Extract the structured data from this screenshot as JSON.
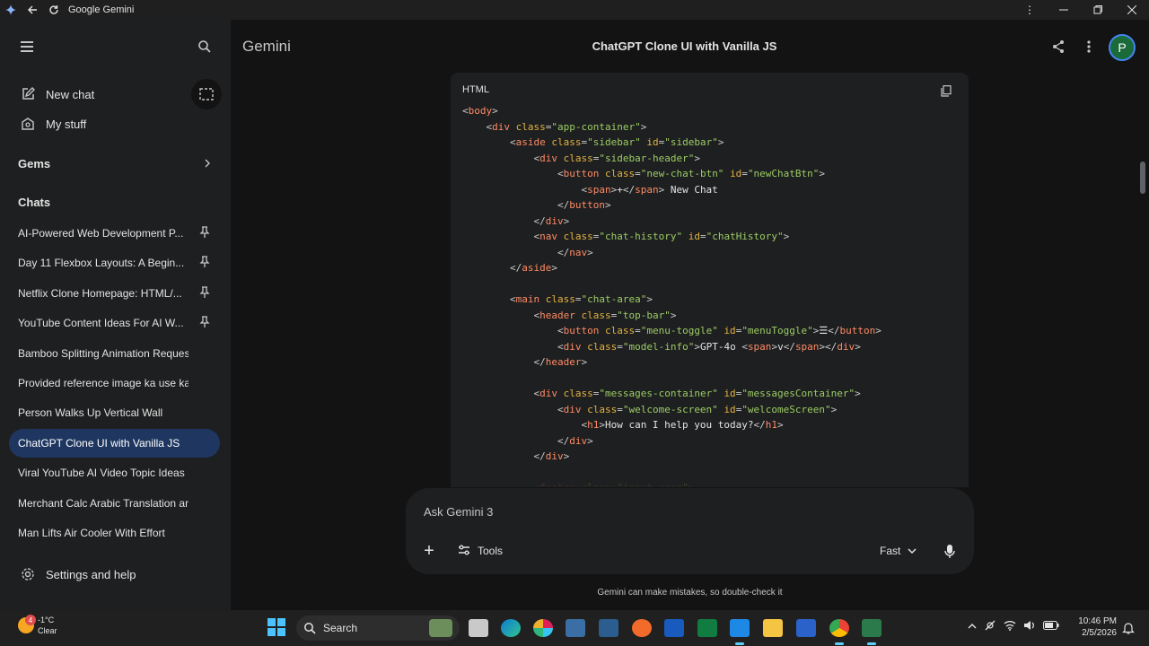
{
  "window": {
    "title": "Google Gemini",
    "controls": [
      "minimize",
      "maximize",
      "close"
    ]
  },
  "sidebar": {
    "new_chat": "New chat",
    "my_stuff": "My stuff",
    "gems": "Gems",
    "chats_header": "Chats",
    "chats": [
      {
        "label": "AI-Powered Web Development P...",
        "pinned": true
      },
      {
        "label": "Day 11 Flexbox Layouts: A Begin...",
        "pinned": true
      },
      {
        "label": "Netflix Clone Homepage: HTML/...",
        "pinned": true
      },
      {
        "label": "YouTube Content Ideas For AI W...",
        "pinned": true
      },
      {
        "label": "Bamboo Splitting Animation Request",
        "pinned": false
      },
      {
        "label": "Provided reference image ka use kart...",
        "pinned": false
      },
      {
        "label": "Person Walks Up Vertical Wall",
        "pinned": false
      },
      {
        "label": "ChatGPT Clone UI with Vanilla JS",
        "pinned": false,
        "active": true
      },
      {
        "label": "Viral YouTube AI Video Topic Ideas",
        "pinned": false
      },
      {
        "label": "Merchant Calc Arabic Translation and...",
        "pinned": false
      },
      {
        "label": "Man Lifts Air Cooler With Effort",
        "pinned": false
      }
    ],
    "settings": "Settings and help"
  },
  "header": {
    "brand": "Gemini",
    "conversation_title": "ChatGPT Clone UI with Vanilla JS",
    "avatar_letter": "P"
  },
  "code_block": {
    "language": "HTML",
    "lines": [
      [
        [
          "br",
          "<"
        ],
        [
          "tag",
          "body"
        ],
        [
          "br",
          ">"
        ]
      ],
      [
        [
          "sp",
          "    "
        ],
        [
          "br",
          "<"
        ],
        [
          "tag",
          "div"
        ],
        [
          "sp",
          " "
        ],
        [
          "attr",
          "class"
        ],
        [
          "br",
          "="
        ],
        [
          "str",
          "\"app-container\""
        ],
        [
          "br",
          ">"
        ]
      ],
      [
        [
          "sp",
          "        "
        ],
        [
          "br",
          "<"
        ],
        [
          "tag",
          "aside"
        ],
        [
          "sp",
          " "
        ],
        [
          "attr",
          "class"
        ],
        [
          "br",
          "="
        ],
        [
          "str",
          "\"sidebar\""
        ],
        [
          "sp",
          " "
        ],
        [
          "attr",
          "id"
        ],
        [
          "br",
          "="
        ],
        [
          "str",
          "\"sidebar\""
        ],
        [
          "br",
          ">"
        ]
      ],
      [
        [
          "sp",
          "            "
        ],
        [
          "br",
          "<"
        ],
        [
          "tag",
          "div"
        ],
        [
          "sp",
          " "
        ],
        [
          "attr",
          "class"
        ],
        [
          "br",
          "="
        ],
        [
          "str",
          "\"sidebar-header\""
        ],
        [
          "br",
          ">"
        ]
      ],
      [
        [
          "sp",
          "                "
        ],
        [
          "br",
          "<"
        ],
        [
          "tag",
          "button"
        ],
        [
          "sp",
          " "
        ],
        [
          "attr",
          "class"
        ],
        [
          "br",
          "="
        ],
        [
          "str",
          "\"new-chat-btn\""
        ],
        [
          "sp",
          " "
        ],
        [
          "attr",
          "id"
        ],
        [
          "br",
          "="
        ],
        [
          "str",
          "\"newChatBtn\""
        ],
        [
          "br",
          ">"
        ]
      ],
      [
        [
          "sp",
          "                    "
        ],
        [
          "br",
          "<"
        ],
        [
          "tag",
          "span"
        ],
        [
          "br",
          ">"
        ],
        [
          "txt",
          "+"
        ],
        [
          "br",
          "</"
        ],
        [
          "tag",
          "span"
        ],
        [
          "br",
          ">"
        ],
        [
          "txt",
          " New Chat"
        ]
      ],
      [
        [
          "sp",
          "                "
        ],
        [
          "br",
          "</"
        ],
        [
          "tag",
          "button"
        ],
        [
          "br",
          ">"
        ]
      ],
      [
        [
          "sp",
          "            "
        ],
        [
          "br",
          "</"
        ],
        [
          "tag",
          "div"
        ],
        [
          "br",
          ">"
        ]
      ],
      [
        [
          "sp",
          "            "
        ],
        [
          "br",
          "<"
        ],
        [
          "tag",
          "nav"
        ],
        [
          "sp",
          " "
        ],
        [
          "attr",
          "class"
        ],
        [
          "br",
          "="
        ],
        [
          "str",
          "\"chat-history\""
        ],
        [
          "sp",
          " "
        ],
        [
          "attr",
          "id"
        ],
        [
          "br",
          "="
        ],
        [
          "str",
          "\"chatHistory\""
        ],
        [
          "br",
          ">"
        ]
      ],
      [
        [
          "sp",
          "                "
        ],
        [
          "br",
          "</"
        ],
        [
          "tag",
          "nav"
        ],
        [
          "br",
          ">"
        ]
      ],
      [
        [
          "sp",
          "        "
        ],
        [
          "br",
          "</"
        ],
        [
          "tag",
          "aside"
        ],
        [
          "br",
          ">"
        ]
      ],
      [
        [
          "sp",
          ""
        ]
      ],
      [
        [
          "sp",
          "        "
        ],
        [
          "br",
          "<"
        ],
        [
          "tag",
          "main"
        ],
        [
          "sp",
          " "
        ],
        [
          "attr",
          "class"
        ],
        [
          "br",
          "="
        ],
        [
          "str",
          "\"chat-area\""
        ],
        [
          "br",
          ">"
        ]
      ],
      [
        [
          "sp",
          "            "
        ],
        [
          "br",
          "<"
        ],
        [
          "tag",
          "header"
        ],
        [
          "sp",
          " "
        ],
        [
          "attr",
          "class"
        ],
        [
          "br",
          "="
        ],
        [
          "str",
          "\"top-bar\""
        ],
        [
          "br",
          ">"
        ]
      ],
      [
        [
          "sp",
          "                "
        ],
        [
          "br",
          "<"
        ],
        [
          "tag",
          "button"
        ],
        [
          "sp",
          " "
        ],
        [
          "attr",
          "class"
        ],
        [
          "br",
          "="
        ],
        [
          "str",
          "\"menu-toggle\""
        ],
        [
          "sp",
          " "
        ],
        [
          "attr",
          "id"
        ],
        [
          "br",
          "="
        ],
        [
          "str",
          "\"menuToggle\""
        ],
        [
          "br",
          ">"
        ],
        [
          "txt",
          "☰"
        ],
        [
          "br",
          "</"
        ],
        [
          "tag",
          "button"
        ],
        [
          "br",
          ">"
        ]
      ],
      [
        [
          "sp",
          "                "
        ],
        [
          "br",
          "<"
        ],
        [
          "tag",
          "div"
        ],
        [
          "sp",
          " "
        ],
        [
          "attr",
          "class"
        ],
        [
          "br",
          "="
        ],
        [
          "str",
          "\"model-info\""
        ],
        [
          "br",
          ">"
        ],
        [
          "txt",
          "GPT-4o "
        ],
        [
          "br",
          "<"
        ],
        [
          "tag",
          "span"
        ],
        [
          "br",
          ">"
        ],
        [
          "txt",
          "v"
        ],
        [
          "br",
          "</"
        ],
        [
          "tag",
          "span"
        ],
        [
          "br",
          "></"
        ],
        [
          "tag",
          "div"
        ],
        [
          "br",
          ">"
        ]
      ],
      [
        [
          "sp",
          "            "
        ],
        [
          "br",
          "</"
        ],
        [
          "tag",
          "header"
        ],
        [
          "br",
          ">"
        ]
      ],
      [
        [
          "sp",
          ""
        ]
      ],
      [
        [
          "sp",
          "            "
        ],
        [
          "br",
          "<"
        ],
        [
          "tag",
          "div"
        ],
        [
          "sp",
          " "
        ],
        [
          "attr",
          "class"
        ],
        [
          "br",
          "="
        ],
        [
          "str",
          "\"messages-container\""
        ],
        [
          "sp",
          " "
        ],
        [
          "attr",
          "id"
        ],
        [
          "br",
          "="
        ],
        [
          "str",
          "\"messagesContainer\""
        ],
        [
          "br",
          ">"
        ]
      ],
      [
        [
          "sp",
          "                "
        ],
        [
          "br",
          "<"
        ],
        [
          "tag",
          "div"
        ],
        [
          "sp",
          " "
        ],
        [
          "attr",
          "class"
        ],
        [
          "br",
          "="
        ],
        [
          "str",
          "\"welcome-screen\""
        ],
        [
          "sp",
          " "
        ],
        [
          "attr",
          "id"
        ],
        [
          "br",
          "="
        ],
        [
          "str",
          "\"welcomeScreen\""
        ],
        [
          "br",
          ">"
        ]
      ],
      [
        [
          "sp",
          "                    "
        ],
        [
          "br",
          "<"
        ],
        [
          "tag",
          "h1"
        ],
        [
          "br",
          ">"
        ],
        [
          "txt",
          "How can I help you today?"
        ],
        [
          "br",
          "</"
        ],
        [
          "tag",
          "h1"
        ],
        [
          "br",
          ">"
        ]
      ],
      [
        [
          "sp",
          "                "
        ],
        [
          "br",
          "</"
        ],
        [
          "tag",
          "div"
        ],
        [
          "br",
          ">"
        ]
      ],
      [
        [
          "sp",
          "            "
        ],
        [
          "br",
          "</"
        ],
        [
          "tag",
          "div"
        ],
        [
          "br",
          ">"
        ]
      ],
      [
        [
          "sp",
          ""
        ]
      ],
      [
        [
          "sp",
          "            "
        ],
        [
          "br",
          "<"
        ],
        [
          "tag",
          "footer"
        ],
        [
          "sp",
          " "
        ],
        [
          "attr",
          "class"
        ],
        [
          "br",
          "="
        ],
        [
          "str",
          "\"input-area\""
        ],
        [
          "br",
          ">"
        ]
      ]
    ]
  },
  "input": {
    "placeholder": "Ask Gemini 3",
    "tools_label": "Tools",
    "mode_label": "Fast",
    "disclaimer": "Gemini can make mistakes, so double-check it"
  },
  "taskbar": {
    "weather_temp": "-1°C",
    "weather_cond": "Clear",
    "weather_badge": "4",
    "search_label": "Search",
    "time": "10:46 PM",
    "date": "2/5/2026"
  },
  "colors": {
    "accent": "#4285f4",
    "active_chat_bg": "#1f3760",
    "avatar_bg": "#1b6b3a"
  }
}
